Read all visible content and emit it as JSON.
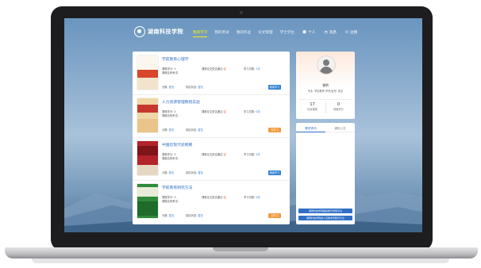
{
  "logo": {
    "text": "湖南科技学院"
  },
  "nav": {
    "links": [
      "我的学习",
      "我的考试",
      "我的作业",
      "论文管理",
      "学士学位"
    ],
    "user": "个人",
    "messages": "消息",
    "logout": "注销"
  },
  "labels": {
    "credits": "课程学分:",
    "paper_status": "课程论文是否通过:",
    "attempts": "学习次数:",
    "exam_name": "课程名称考试:",
    "score_label": "分数:",
    "status_label": "成绩状态:",
    "score_value": "暂无",
    "exam_value": "暂无",
    "credit_value": "3",
    "paper_value": "否",
    "attempts_value": "1次"
  },
  "courses": [
    {
      "title": "学前教育心理学",
      "attempts": "1次",
      "button": "继续学习",
      "button_color": "#2f7fd3"
    },
    {
      "title": "人力资源管理教程实验",
      "attempts": "0次",
      "button": "去学习",
      "button_color": "#f39a3b"
    },
    {
      "title": "中国近现代史纲要",
      "attempts": "1次",
      "button": "继续学习",
      "button_color": "#2f7fd3"
    },
    {
      "title": "学前教育研究方法",
      "attempts": "0次",
      "button": "去学习",
      "button_color": "#f39a3b"
    }
  ],
  "profile": {
    "name": "曾明",
    "info": "专业: 学前教育    学号/证号: 暂无",
    "stats": [
      {
        "value": "17",
        "label": "在读课程"
      },
      {
        "value": "0",
        "label": "暂缓学分"
      }
    ]
  },
  "notice": {
    "tabs": [
      "教学资讯",
      "通知公告"
    ],
    "buttons": [
      "湖南科技学院继续教育学院平台",
      "湖南科技学院成人高等学历教育平台"
    ]
  },
  "colors": {
    "accent": "#2e6fc4",
    "nav_active": "#fff200",
    "orange": "#f39a3b",
    "blue_button": "#2f7fd3"
  }
}
